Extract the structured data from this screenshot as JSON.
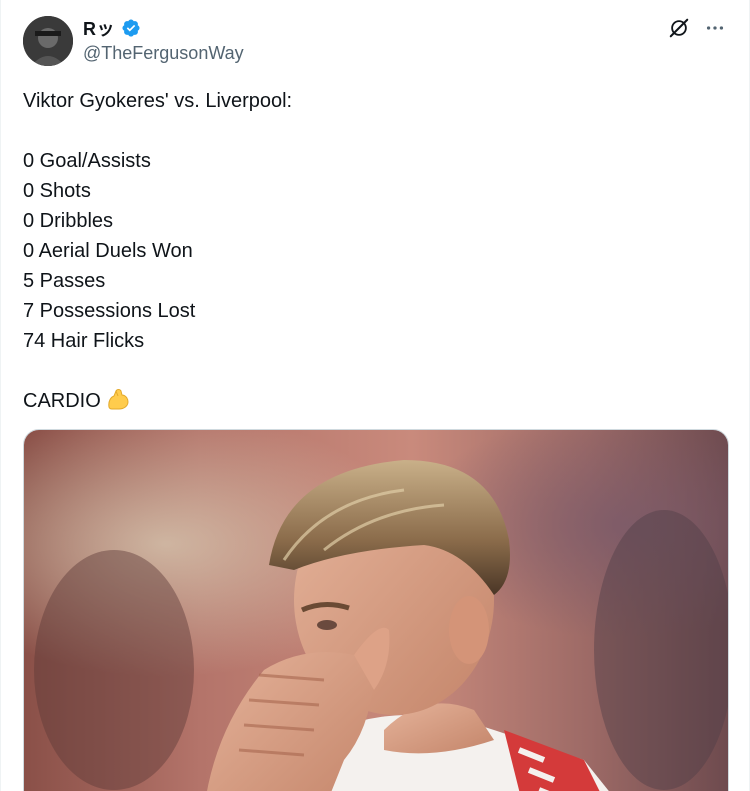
{
  "author": {
    "display_name": "Rッ",
    "handle": "@TheFergusonWay",
    "verified": true,
    "verified_color": "#1d9bf0"
  },
  "actions": {
    "grok_icon": "grok-icon",
    "more_icon": "more-icon"
  },
  "tweet": {
    "title_line": "Viktor Gyokeres' vs. Liverpool:",
    "stats": [
      "0 Goal/Assists",
      "0 Shots",
      "0 Dribbles",
      "0 Aerial Duels Won",
      "5 Passes",
      "7 Possessions Lost",
      "74 Hair Flicks"
    ],
    "closing": "CARDIO",
    "closing_emoji": "flexed-biceps-emoji"
  },
  "media": {
    "type": "photo",
    "subject": "football-player-hands-over-face"
  },
  "colors": {
    "text_primary": "#0f1419",
    "text_secondary": "#536471",
    "border": "#cfd9de"
  }
}
